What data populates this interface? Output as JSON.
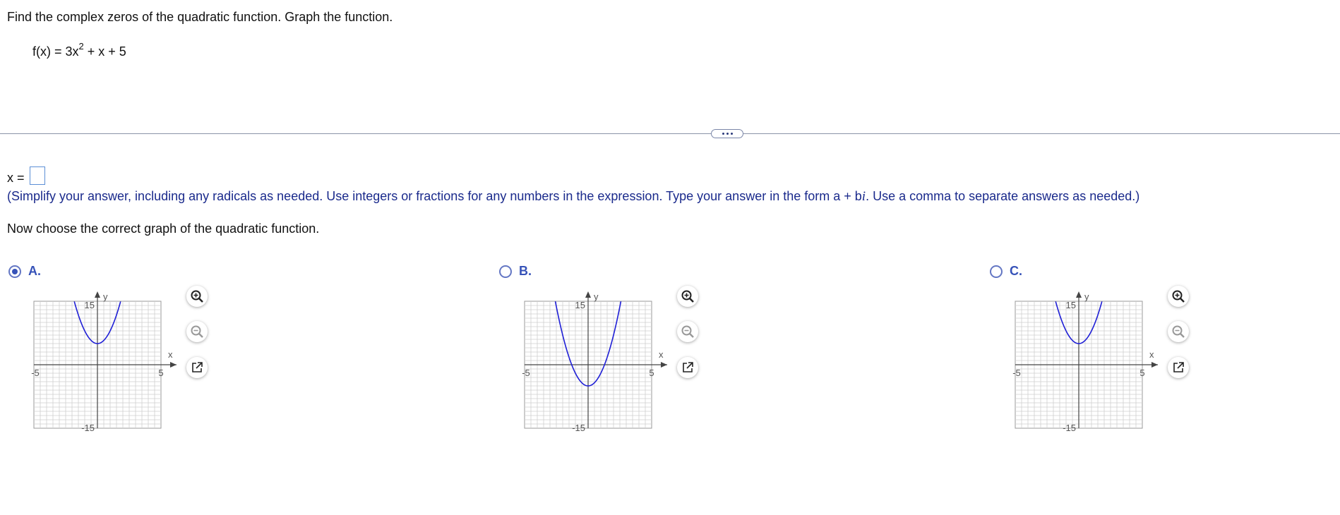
{
  "question": "Find the complex zeros of the quadratic function. Graph the function.",
  "function": {
    "lhs": "f(x) = 3x",
    "exponent": "2",
    "rhs": " + x + 5"
  },
  "answer": {
    "label": "x =",
    "value": "",
    "instructions_pre": "(Simplify your answer, including any radicals as needed. Use integers or fractions for any numbers in the expression. Type your answer in the form a + b",
    "instructions_italic": "i",
    "instructions_post": ". Use a comma to separate answers as needed.)"
  },
  "prompt": "Now choose the correct graph of the quadratic function.",
  "options": [
    {
      "letter": "A.",
      "selected": true
    },
    {
      "letter": "B.",
      "selected": false
    },
    {
      "letter": "C.",
      "selected": false
    }
  ],
  "graph_labels": {
    "x_axis": "x",
    "y_axis": "y",
    "x_min": "-5",
    "x_max": "5",
    "y_max": "15",
    "y_min": "-15"
  },
  "tools": {
    "zoom_in": "zoom-in-icon",
    "zoom_out": "zoom-out-icon",
    "popout": "popout-icon"
  },
  "colors": {
    "curve": "#1f1fd6",
    "accent": "#3652b8",
    "instructions": "#1a2a8c"
  },
  "chart_data": [
    {
      "type": "line",
      "xlim": [
        -5,
        5
      ],
      "ylim": [
        -15,
        15
      ],
      "curve": "parabola opening up",
      "vertex": [
        0,
        5
      ]
    },
    {
      "type": "line",
      "xlim": [
        -5,
        5
      ],
      "ylim": [
        -15,
        15
      ],
      "curve": "parabola opening up",
      "vertex": [
        0,
        -5
      ]
    },
    {
      "type": "line",
      "xlim": [
        -5,
        5
      ],
      "ylim": [
        -15,
        15
      ],
      "curve": "parabola opening up",
      "vertex": [
        0,
        5
      ]
    }
  ]
}
